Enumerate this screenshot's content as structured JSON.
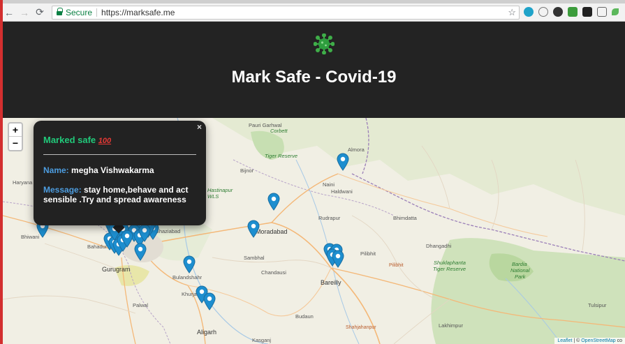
{
  "browser": {
    "secure_label": "Secure",
    "url": "https://marksafe.me",
    "back_icon": "arrow-back-icon",
    "forward_icon": "arrow-forward-icon",
    "reload_icon": "reload-icon",
    "star_icon": "star-icon"
  },
  "header": {
    "logo_icon": "virus-icon",
    "title": "Mark Safe - Covid-19"
  },
  "map": {
    "zoom_in": "+",
    "zoom_out": "−",
    "attribution": {
      "leaflet": "Leaflet",
      "sep": " | © ",
      "osm": "OpenStreetMap",
      "tail": " co"
    },
    "places": {
      "pauri_garhwal": "Pauri Garhwal",
      "corbett": "Corbett",
      "tiger_reserve": "Tiger Reserve",
      "almora": "Almora",
      "haldwani": "Haldwani",
      "nainital": "Naini",
      "bijnor": "Bijnor",
      "moradabad": "Moradabad",
      "rudrapur": "Rudrapur",
      "bhimdatta": "Bhimdatta",
      "dhangadhi": "Dhangadhi",
      "bardia": "Bardia",
      "national": "National",
      "park": "Park",
      "shuklaphanta": "Shuklaphanta",
      "tiger_reserve2": "Tiger Reserve",
      "haryana": "Haryana",
      "bhiwani": "Bhiwani",
      "bahadurgarh": "Bahadur",
      "gurugram": "Gurugram",
      "ghaziabad": "Ghaziabad",
      "sambhal": "Sambhal",
      "pilibhit": "Pilibhit",
      "pilibhit2": "Pilibhit",
      "chandausi": "Chandausi",
      "bareilly": "Bareilly",
      "bulandshahr": "Bulandshahr",
      "khurja": "Khurja",
      "palwal": "Palwal",
      "aligarh": "Aligarh",
      "budaun": "Budaun",
      "shahjahanpur": "Shahjahanpur",
      "lakhimpur": "Lakhimpur",
      "tulsipur": "Tulsipur",
      "kasganj": "Kasganj",
      "hastinapur": "Hastinapur",
      "wls": "WLS"
    },
    "marker_icon": "map-pin-icon"
  },
  "popup": {
    "close": "×",
    "title": "Marked safe",
    "title_emoji": "100",
    "name_key": "Name:",
    "name_value": "megha Vishwakarma",
    "message_key": "Message:",
    "message_value": "stay home,behave and act sensible .Try and spread awareness"
  },
  "colors": {
    "header_bg": "#232323",
    "popup_bg": "#222222",
    "accent_green": "#21c97a",
    "key_blue": "#4d9de0",
    "marker_blue": "#1d8ecf"
  }
}
